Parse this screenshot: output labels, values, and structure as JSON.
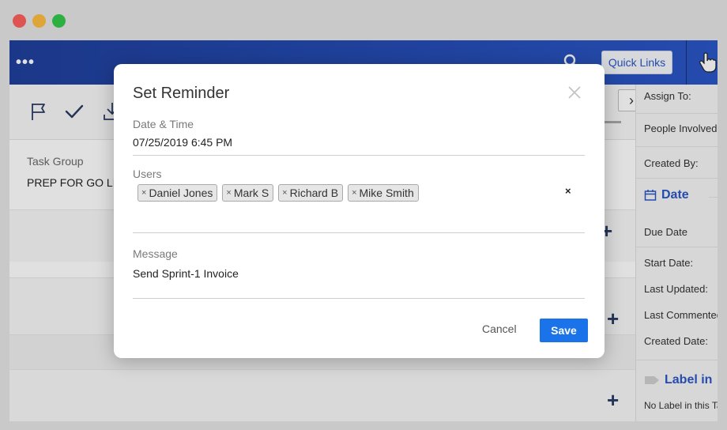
{
  "window": {
    "controls": [
      "close",
      "minimize",
      "maximize"
    ]
  },
  "topbar": {
    "menu_icon": "more-dots-icon",
    "search_icon": "search-icon",
    "quick_links_label": "Quick Links",
    "user_icon": "pointer-hand-icon",
    "color": "#2a56c6"
  },
  "toolbar": {
    "icons": [
      "flag-icon",
      "check-icon",
      "download-icon"
    ],
    "next_label": "›"
  },
  "task": {
    "group_label": "Task Group",
    "group_value": "PREP FOR GO LIVE"
  },
  "right_panel": {
    "assign_to": "Assign To:",
    "people_involved": "People Involved",
    "created_by": "Created By:",
    "date_heading": "Date",
    "due_date": "Due Date",
    "start_date": "Start Date:",
    "last_updated": "Last Updated:",
    "last_commented": "Last Commented:",
    "created_date": "Created Date:",
    "label_heading": "Label in",
    "no_label": "No Label in this Task"
  },
  "modal": {
    "title": "Set Reminder",
    "date_time_label": "Date & Time",
    "date_time_value": "07/25/2019 6:45 PM",
    "users_label": "Users",
    "users": [
      {
        "name": "Daniel Jones"
      },
      {
        "name": "Mark S"
      },
      {
        "name": "Richard B"
      },
      {
        "name": "Mike Smith"
      }
    ],
    "chip_remove": "×",
    "clear_all": "×",
    "message_label": "Message",
    "message_value": "Send Sprint-1 Invoice",
    "cancel_label": "Cancel",
    "save_label": "Save",
    "save_color": "#1a73e8"
  }
}
